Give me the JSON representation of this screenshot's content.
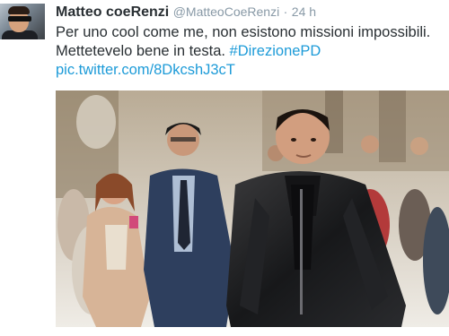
{
  "tweet": {
    "display_name": "Matteo coeRenzi",
    "handle": "@MatteoCoeRenzi",
    "separator": "·",
    "time": "24 h",
    "text_line1": "Per uno cool come me, non esistono missioni impossibili.",
    "text_line2_prefix": "Mettetevelo bene in testa.",
    "hashtag": "#DirezionePD",
    "media_link": "pic.twitter.com/8DkcshJ3cT"
  },
  "colors": {
    "text": "#292f33",
    "meta": "#8899a6",
    "link": "#1d9bd8"
  }
}
